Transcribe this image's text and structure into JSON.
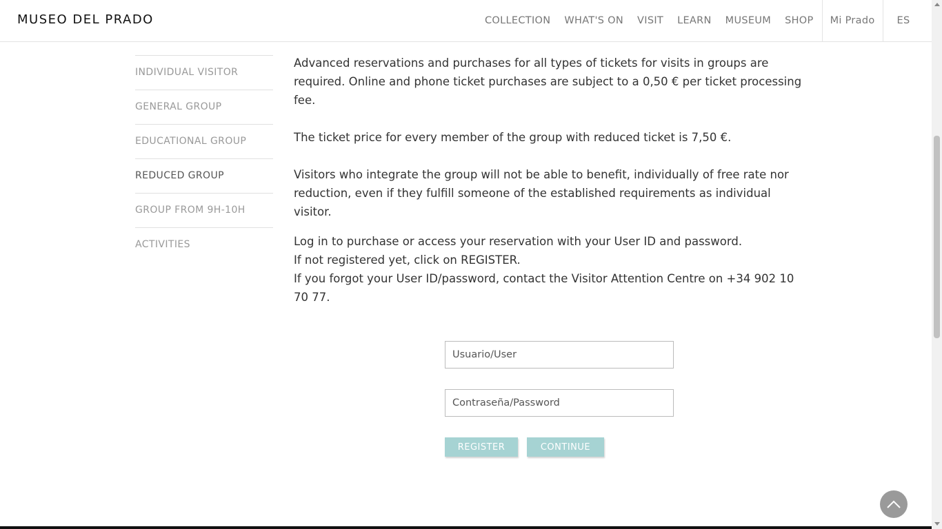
{
  "header": {
    "logo": "MUSEO DEL PRADO",
    "nav": [
      "COLLECTION",
      "WHAT'S ON",
      "VISIT",
      "LEARN",
      "MUSEUM",
      "SHOP"
    ],
    "mi_prado": "Mi Prado",
    "language": "ES"
  },
  "sidebar": {
    "items": [
      {
        "label": "INDIVIDUAL VISITOR"
      },
      {
        "label": "GENERAL GROUP"
      },
      {
        "label": "EDUCATIONAL GROUP"
      },
      {
        "label": "REDUCED GROUP"
      },
      {
        "label": "GROUP FROM 9H-10H"
      },
      {
        "label": "ACTIVITIES"
      }
    ],
    "active": "REDUCED GROUP"
  },
  "content": {
    "p1": "Advanced reservations and purchases for all types of tickets for visits in groups are required. Online and phone ticket purchases are subject to a 0,50 € per ticket processing fee.",
    "p2": "The ticket price for every member of the group with reduced ticket is 7,50 €.",
    "p3": "Visitors who integrate the group will not be able to benefit, individually of free rate nor reduction, even if they fulfill someone of the established requirements as individual visitor.",
    "login_line1": "Log in to purchase or access your reservation with your User ID and password.",
    "login_line2": "If not registered yet, click on REGISTER.",
    "login_line3": "If you forgot your User ID/password, contact the Visitor Attention Centre on +34 902 10 70 77."
  },
  "form": {
    "user_placeholder": "Usuario/User",
    "password_placeholder": "Contraseña/Password",
    "register_label": "REGISTER",
    "continue_label": "CONTINUE"
  },
  "colors": {
    "button": "#a6d3d3",
    "scroll_top_button": "#9a9a9a"
  },
  "icons": {
    "scroll_top": "chevron-up-icon"
  }
}
